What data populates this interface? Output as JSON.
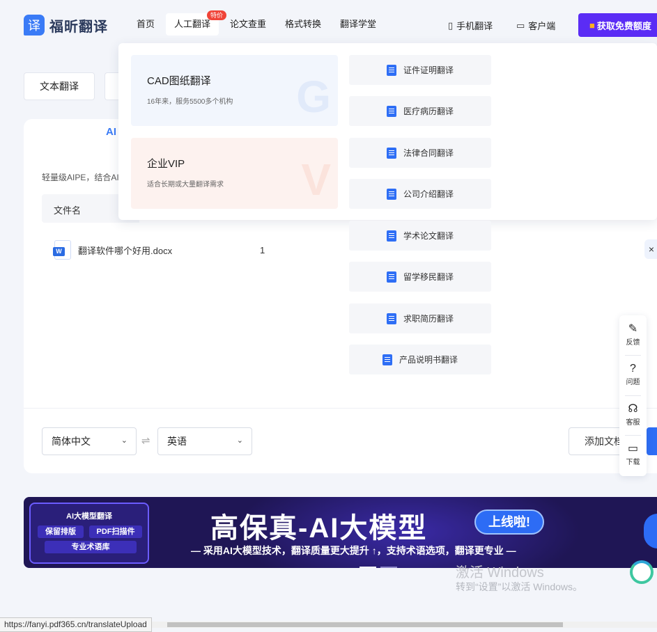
{
  "header": {
    "logo_mark": "译",
    "logo_text": "福昕翻译",
    "nav": [
      "首页",
      "人工翻译",
      "论文查重",
      "格式转换",
      "翻译学堂"
    ],
    "hot_badge": "特价",
    "mobile_link": "手机翻译",
    "client_link": "客户端",
    "free_button": "获取免费额度"
  },
  "page_tabs": {
    "text_translate": "文本翻译"
  },
  "card": {
    "title_fragment": "AI",
    "description": "轻量级AIPE，结合AI",
    "table_header": "文件名",
    "file": {
      "name": "翻译软件哪个好用.docx",
      "count": "1"
    },
    "close": "×",
    "source_lang": "简体中文",
    "target_lang": "英语",
    "swap": "⇌",
    "add_doc": "添加文档"
  },
  "dropdown": {
    "promos": [
      {
        "title": "CAD图纸翻译",
        "subtitle": "16年来，服务5500多个机构",
        "deco": "G"
      },
      {
        "title": "企业VIP",
        "subtitle": "适合长期或大量翻译需求",
        "deco": "V"
      }
    ],
    "services": [
      "证件证明翻译",
      "医疗病历翻译",
      "法律合同翻译",
      "公司介绍翻译",
      "学术论文翻译",
      "留学移民翻译",
      "求职简历翻译",
      "产品说明书翻译"
    ]
  },
  "float_bar": [
    "反馈",
    "问题",
    "客服",
    "下载"
  ],
  "banner": {
    "box_title": "AI大模型翻译",
    "tag_keep": "保留排版",
    "tag_pdf": "PDF扫描件",
    "tag_term": "专业术语库",
    "title": "高保真-AI大模型",
    "badge": "上线啦!",
    "subtitle": "— 采用AI大模型技术，翻译质量更大提升 ↑，支持术语选项，翻译更专业 —"
  },
  "watermark": {
    "line1": "激活 Windows",
    "line2": "转到“设置”以激活 Windows。"
  },
  "status_url": "https://fanyi.pdf365.cn/translateUpload",
  "colors": {
    "accent": "#2e6ef5",
    "free_button": "#5b2cf5",
    "banner_bg": "#1f1655",
    "hot": "#f04438"
  }
}
